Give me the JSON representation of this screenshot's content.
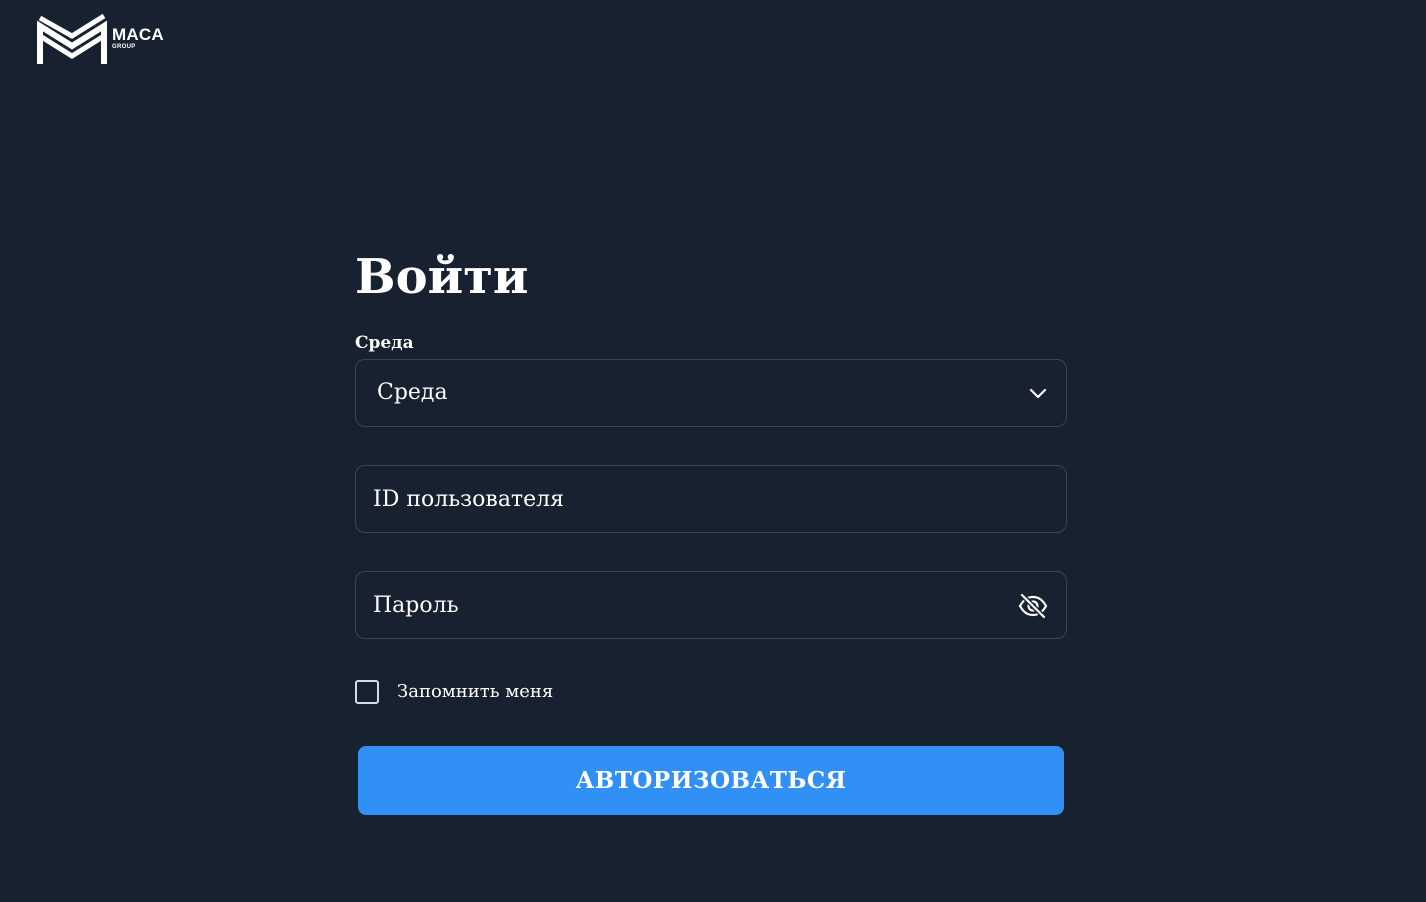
{
  "brand": {
    "name": "MACA",
    "subtitle": "GROUP",
    "icon": "maca-logo-icon"
  },
  "login": {
    "title": "Войти",
    "environment_label": "Среда",
    "environment_value": "Среда",
    "user_id_placeholder": "ID пользователя",
    "password_placeholder": "Пароль",
    "password_visibility_icon": "eye-slash-icon",
    "remember_me_label": "Запомнить меня",
    "remember_me_checked": false,
    "submit_label": "АВТОРИЗОВАТЬСЯ"
  },
  "colors": {
    "background": "#18212f",
    "field_border": "#3a4557",
    "primary_button": "#3190f6",
    "text": "#ffffff"
  }
}
